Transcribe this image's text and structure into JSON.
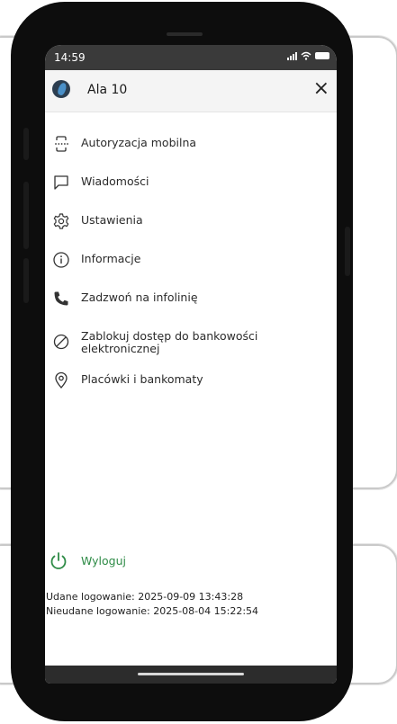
{
  "status_bar": {
    "time": "14:59"
  },
  "header": {
    "username": "Ala 10",
    "close_symbol": "×"
  },
  "menu": {
    "items": [
      {
        "label": "Autoryzacja mobilna",
        "icon": "mobile-auth-icon"
      },
      {
        "label": "Wiadomości",
        "icon": "message-icon"
      },
      {
        "label": "Ustawienia",
        "icon": "gear-icon"
      },
      {
        "label": "Informacje",
        "icon": "info-icon"
      },
      {
        "label": "Zadzwoń na infolinię",
        "icon": "phone-icon"
      },
      {
        "label": "Zablokuj dostęp do bankowości elektronicznej",
        "icon": "block-icon"
      },
      {
        "label": "Placówki i bankomaty",
        "icon": "location-pin-icon"
      }
    ]
  },
  "logout": {
    "label": "Wyloguj",
    "icon": "power-icon"
  },
  "logins": {
    "success": "Udane logowanie: 2025-09-09 13:43:28",
    "failed": "Nieudane logowanie: 2025-08-04 15:22:54"
  },
  "colors": {
    "accent_green": "#2e8b46",
    "status_bar": "#3a3a3a",
    "header_bg": "#f4f4f4"
  }
}
